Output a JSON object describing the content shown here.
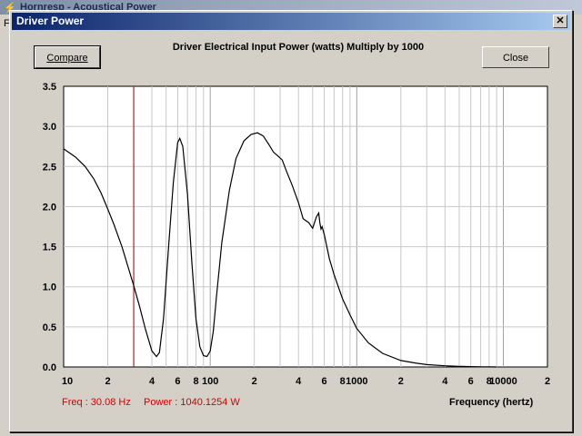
{
  "background_window": {
    "title": "Hornresp - Acoustical Power",
    "menu_letter": "F",
    "icon": "lightning-icon"
  },
  "dialog": {
    "title": "Driver Power",
    "close_icon": "close-icon",
    "compare_label": "Compare",
    "close_label": "Close",
    "chart_title": "Driver Electrical Input Power (watts)   Multiply by 1000"
  },
  "readouts": {
    "freq": "Freq : 30.08 Hz",
    "power": "Power : 1040.1254 W"
  },
  "chart_data": {
    "type": "line",
    "title": "Driver Electrical Input Power (watts)   Multiply by 1000",
    "xlabel": "Frequency (hertz)",
    "ylabel": "",
    "xscale": "log",
    "xlim": [
      10,
      20000
    ],
    "ylim": [
      0,
      3.5
    ],
    "yticks": [
      "0.0",
      "0.5",
      "1.0",
      "1.5",
      "2.0",
      "2.5",
      "3.0",
      "3.5"
    ],
    "xtick_labels": [
      {
        "value": 10,
        "label": "10"
      },
      {
        "value": 20,
        "label": "2"
      },
      {
        "value": 40,
        "label": "4"
      },
      {
        "value": 60,
        "label": "6"
      },
      {
        "value": 80,
        "label": "8"
      },
      {
        "value": 100,
        "label": "100"
      },
      {
        "value": 200,
        "label": "2"
      },
      {
        "value": 400,
        "label": "4"
      },
      {
        "value": 600,
        "label": "6"
      },
      {
        "value": 800,
        "label": "8"
      },
      {
        "value": 1000,
        "label": "1000"
      },
      {
        "value": 2000,
        "label": "2"
      },
      {
        "value": 4000,
        "label": "4"
      },
      {
        "value": 6000,
        "label": "6"
      },
      {
        "value": 8000,
        "label": "8"
      },
      {
        "value": 10000,
        "label": "10000"
      },
      {
        "value": 20000,
        "label": "2"
      }
    ],
    "grid": true,
    "cursor_x": 30.08,
    "colors": {
      "line": "#000000",
      "cursor": "#b00000",
      "grid": "#c8c8c8",
      "readout": "#d00000"
    },
    "series": [
      {
        "x": [
          10,
          12,
          14,
          16,
          18,
          20,
          22,
          25,
          28,
          30,
          33,
          36,
          40,
          43,
          45,
          48,
          52,
          56,
          60,
          62,
          65,
          70,
          75,
          80,
          85,
          90,
          95,
          100,
          105,
          110,
          120,
          135,
          150,
          170,
          190,
          210,
          230,
          250,
          270,
          290,
          310,
          330,
          360,
          400,
          430,
          470,
          500,
          530,
          550,
          560,
          570,
          580,
          600,
          650,
          700,
          800,
          900,
          1000,
          1200,
          1500,
          2000,
          2500,
          3000,
          4000,
          5000,
          6000,
          7000,
          8000,
          9000
        ],
        "y": [
          2.72,
          2.62,
          2.5,
          2.35,
          2.17,
          1.97,
          1.78,
          1.5,
          1.2,
          1.02,
          0.75,
          0.48,
          0.2,
          0.13,
          0.18,
          0.6,
          1.5,
          2.3,
          2.8,
          2.85,
          2.75,
          2.15,
          1.3,
          0.6,
          0.25,
          0.14,
          0.13,
          0.2,
          0.45,
          0.85,
          1.55,
          2.2,
          2.6,
          2.82,
          2.9,
          2.92,
          2.88,
          2.78,
          2.68,
          2.63,
          2.58,
          2.45,
          2.28,
          2.05,
          1.85,
          1.8,
          1.73,
          1.87,
          1.92,
          1.8,
          1.72,
          1.75,
          1.65,
          1.35,
          1.15,
          0.85,
          0.65,
          0.48,
          0.3,
          0.17,
          0.08,
          0.05,
          0.03,
          0.015,
          0.008,
          0.004,
          0.002,
          0.001,
          0.0
        ]
      }
    ]
  }
}
